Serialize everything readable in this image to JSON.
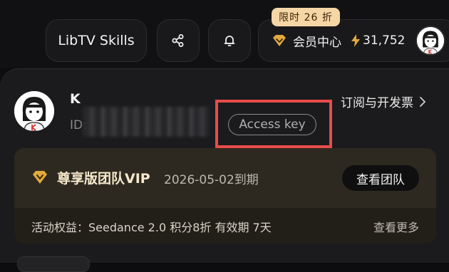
{
  "topbar": {
    "skills_label": "LibTV Skills",
    "member_center": "会员中心",
    "credits": "31,752",
    "promo_badge": "限时 26 折"
  },
  "profile": {
    "name": "K",
    "id_label": "ID:",
    "access_key_label": "Access key",
    "subscribe_link": "订阅与开发票"
  },
  "vip": {
    "plan_name": "尊享版团队VIP",
    "expire": "2026-05-02到期",
    "view_team": "查看团队",
    "benefit": "活动权益：Seedance 2.0 积分8折 有效期 7天",
    "see_more": "查看更多"
  },
  "colors": {
    "highlight": "#e94b4b",
    "gold": "#e2a93b",
    "promo_bg": "#f7d6a6"
  }
}
